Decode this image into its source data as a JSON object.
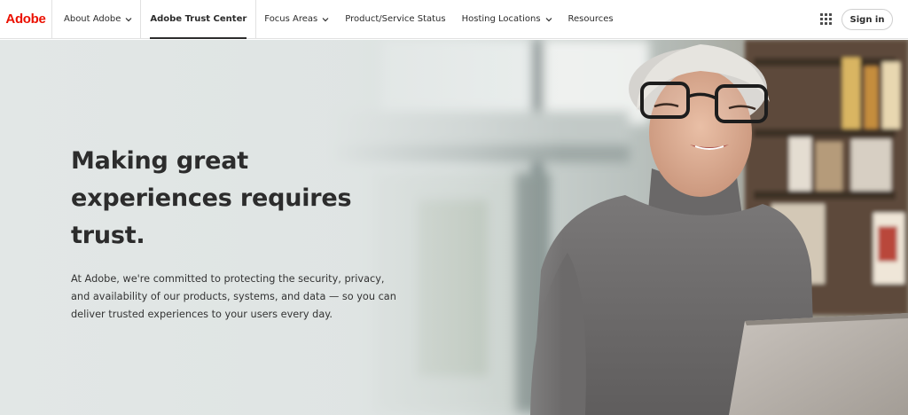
{
  "brand": {
    "logo_text": "Adobe",
    "color": "#eb1000"
  },
  "nav": {
    "items": [
      {
        "label": "About Adobe",
        "has_dropdown": true
      },
      {
        "label": "Adobe Trust Center",
        "active": true
      },
      {
        "label": "Focus Areas",
        "has_dropdown": true
      },
      {
        "label": "Product/Service Status"
      },
      {
        "label": "Hosting Locations",
        "has_dropdown": true
      },
      {
        "label": "Resources"
      }
    ],
    "apps_icon": "apps-grid-icon",
    "signin_label": "Sign in"
  },
  "hero": {
    "title": "Making great experiences requires trust.",
    "title_lines": [
      "Making great",
      "experiences requires",
      "trust."
    ],
    "body": "At Adobe, we're committed to protecting the security, privacy, and availability of our products, systems, and data — so you can deliver trusted experiences to your users every day.",
    "image": "woman-with-glasses-using-laptop"
  }
}
